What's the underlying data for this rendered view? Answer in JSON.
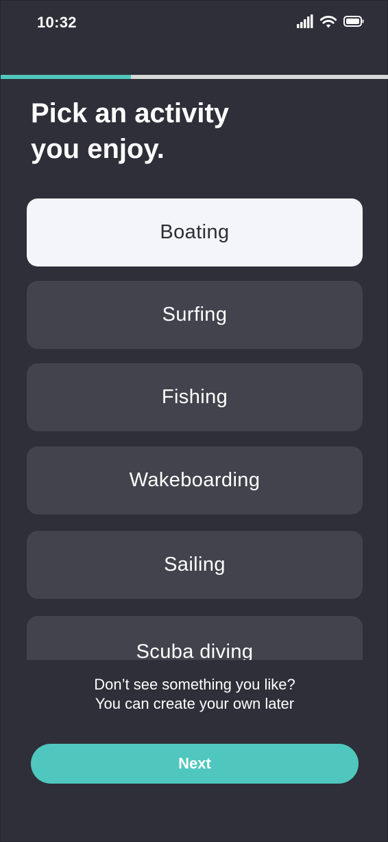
{
  "status_bar": {
    "time": "10:32",
    "icons": [
      "cellular-signal-icon",
      "wifi-icon",
      "battery-icon"
    ]
  },
  "progress": {
    "fraction": 0.335,
    "fill_color": "#4fc7bf",
    "track_color": "#d8d8d8"
  },
  "header": {
    "title_line1": "Pick an activity",
    "title_line2": "you enjoy."
  },
  "options": [
    {
      "label": "Boating",
      "selected": true
    },
    {
      "label": "Surfing",
      "selected": false
    },
    {
      "label": "Fishing",
      "selected": false
    },
    {
      "label": "Wakeboarding",
      "selected": false
    },
    {
      "label": "Sailing",
      "selected": false
    },
    {
      "label": "Scuba diving",
      "selected": false
    }
  ],
  "footer": {
    "helper_line1": "Don’t see something you like?",
    "helper_line2": "You can create your own later",
    "next_label": "Next"
  },
  "colors": {
    "background": "#2f2f39",
    "option_bg": "#42434d",
    "option_selected_bg": "#f4f5fb",
    "accent": "#4fc7bf"
  }
}
